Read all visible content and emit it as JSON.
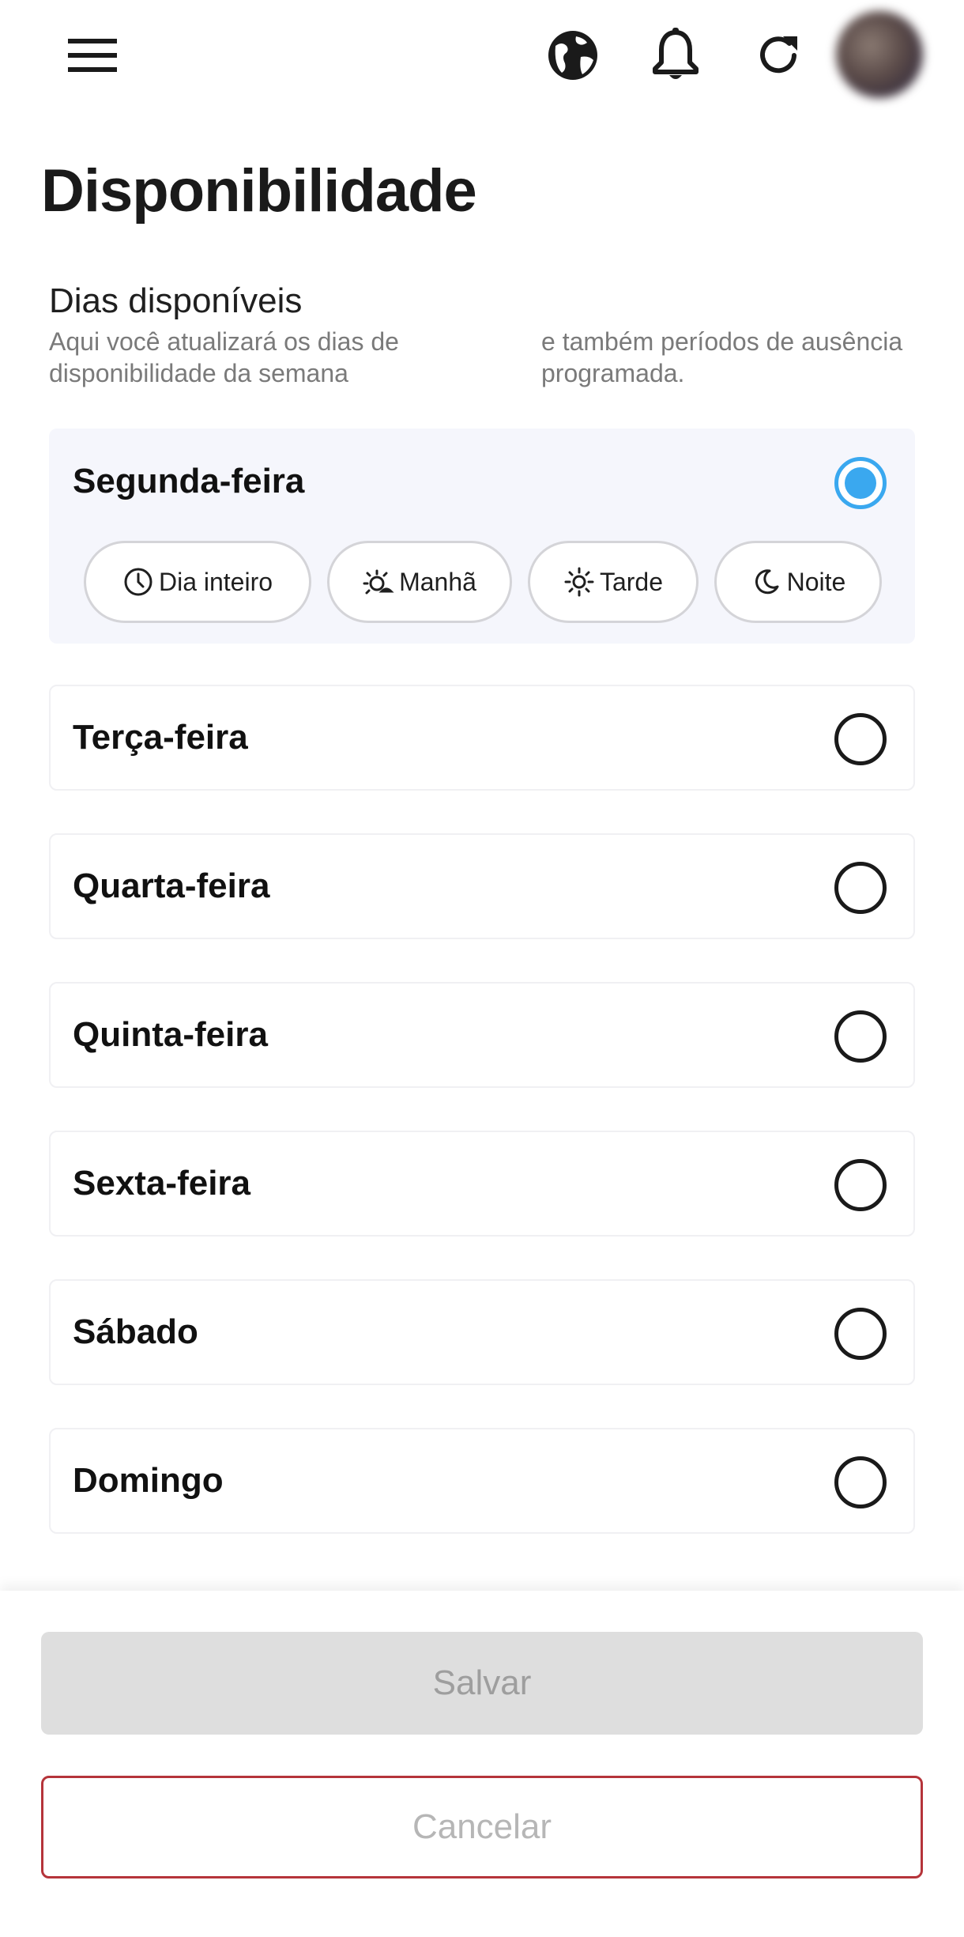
{
  "header": {
    "icons": [
      "menu-icon",
      "globe-icon",
      "bell-icon",
      "refresh-icon",
      "avatar"
    ]
  },
  "page": {
    "title": "Disponibilidade"
  },
  "section": {
    "title": "Dias disponíveis",
    "description_left": "Aqui você atualizará os dias de disponibilidade da semana",
    "description_right": "e também períodos de ausência programada."
  },
  "days": [
    {
      "label": "Segunda-feira",
      "selected": true
    },
    {
      "label": "Terça-feira",
      "selected": false
    },
    {
      "label": "Quarta-feira",
      "selected": false
    },
    {
      "label": "Quinta-feira",
      "selected": false
    },
    {
      "label": "Sexta-feira",
      "selected": false
    },
    {
      "label": "Sábado",
      "selected": false
    },
    {
      "label": "Domingo",
      "selected": false
    }
  ],
  "periods": [
    {
      "label": "Dia inteiro",
      "icon": "clock-icon"
    },
    {
      "label": "Manhã",
      "icon": "sunrise-icon"
    },
    {
      "label": "Tarde",
      "icon": "sun-icon"
    },
    {
      "label": "Noite",
      "icon": "moon-icon"
    }
  ],
  "footer": {
    "save_label": "Salvar",
    "cancel_label": "Cancelar"
  },
  "colors": {
    "accent": "#3aa8ef",
    "cancel_border": "#b5343a",
    "selected_card_bg": "#f5f6fc"
  }
}
